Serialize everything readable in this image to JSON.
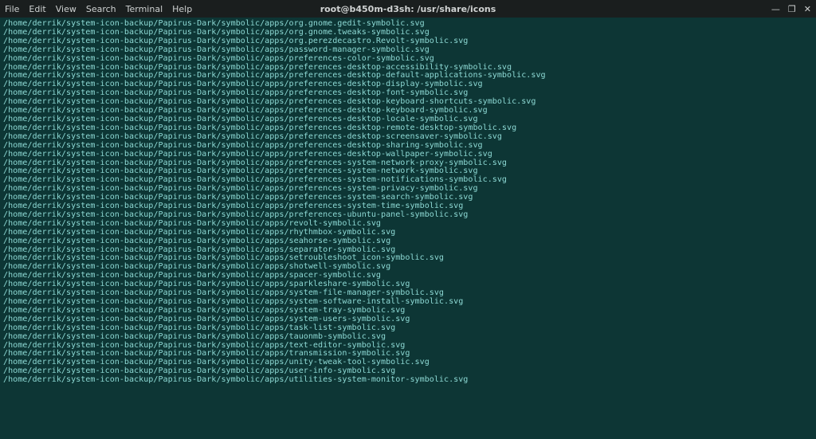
{
  "window": {
    "title": "root@b450m-d3sh: /usr/share/icons",
    "menus": [
      "File",
      "Edit",
      "View",
      "Search",
      "Terminal",
      "Help"
    ],
    "controls": {
      "minimize": "—",
      "maximize": "❐",
      "close": "✕"
    }
  },
  "terminal": {
    "path_prefix": "/home/derrik/system-icon-backup/Papirus-Dark/symbolic/apps/",
    "files": [
      "org.gnome.gedit-symbolic.svg",
      "org.gnome.tweaks-symbolic.svg",
      "org.perezdecastro.Revolt-symbolic.svg",
      "password-manager-symbolic.svg",
      "preferences-color-symbolic.svg",
      "preferences-desktop-accessibility-symbolic.svg",
      "preferences-desktop-default-applications-symbolic.svg",
      "preferences-desktop-display-symbolic.svg",
      "preferences-desktop-font-symbolic.svg",
      "preferences-desktop-keyboard-shortcuts-symbolic.svg",
      "preferences-desktop-keyboard-symbolic.svg",
      "preferences-desktop-locale-symbolic.svg",
      "preferences-desktop-remote-desktop-symbolic.svg",
      "preferences-desktop-screensaver-symbolic.svg",
      "preferences-desktop-sharing-symbolic.svg",
      "preferences-desktop-wallpaper-symbolic.svg",
      "preferences-system-network-proxy-symbolic.svg",
      "preferences-system-network-symbolic.svg",
      "preferences-system-notifications-symbolic.svg",
      "preferences-system-privacy-symbolic.svg",
      "preferences-system-search-symbolic.svg",
      "preferences-system-time-symbolic.svg",
      "preferences-ubuntu-panel-symbolic.svg",
      "revolt-symbolic.svg",
      "rhythmbox-symbolic.svg",
      "seahorse-symbolic.svg",
      "separator-symbolic.svg",
      "setroubleshoot_icon-symbolic.svg",
      "shotwell-symbolic.svg",
      "spacer-symbolic.svg",
      "sparkleshare-symbolic.svg",
      "system-file-manager-symbolic.svg",
      "system-software-install-symbolic.svg",
      "system-tray-symbolic.svg",
      "system-users-symbolic.svg",
      "task-list-symbolic.svg",
      "tauonmb-symbolic.svg",
      "text-editor-symbolic.svg",
      "transmission-symbolic.svg",
      "unity-tweak-tool-symbolic.svg",
      "user-info-symbolic.svg",
      "utilities-system-monitor-symbolic.svg"
    ]
  }
}
